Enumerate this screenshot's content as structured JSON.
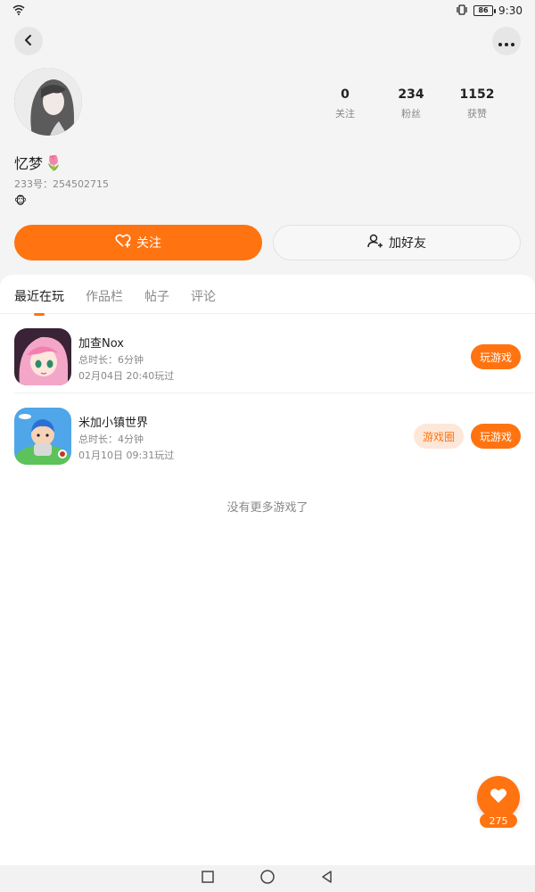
{
  "status_bar": {
    "battery": "86",
    "time": "9:30"
  },
  "profile": {
    "name": "忆梦",
    "name_emoji": "🌷",
    "uid": "233号：254502715",
    "badge_emoji": "🐵",
    "stats": [
      {
        "value": "0",
        "label": "关注"
      },
      {
        "value": "234",
        "label": "粉丝"
      },
      {
        "value": "1152",
        "label": "获赞"
      }
    ]
  },
  "actions": {
    "follow_label": "关注",
    "add_friend_label": "加好友"
  },
  "tabs": [
    {
      "label": "最近在玩",
      "active": true
    },
    {
      "label": "作品栏",
      "active": false
    },
    {
      "label": "帖子",
      "active": false
    },
    {
      "label": "评论",
      "active": false
    }
  ],
  "games": [
    {
      "title": "加查Nox",
      "duration": "总时长：6分钟",
      "last_played": "02月04日 20:40玩过",
      "play_label": "玩游戏"
    },
    {
      "title": "米加小镇世界",
      "duration": "总时长：4分钟",
      "last_played": "01月10日 09:31玩过",
      "circle_label": "游戏圈",
      "play_label": "玩游戏"
    }
  ],
  "empty_text": "没有更多游戏了",
  "fab": {
    "count": "275"
  },
  "colors": {
    "accent": "#ff7310",
    "accent_light": "#fde7d8"
  }
}
